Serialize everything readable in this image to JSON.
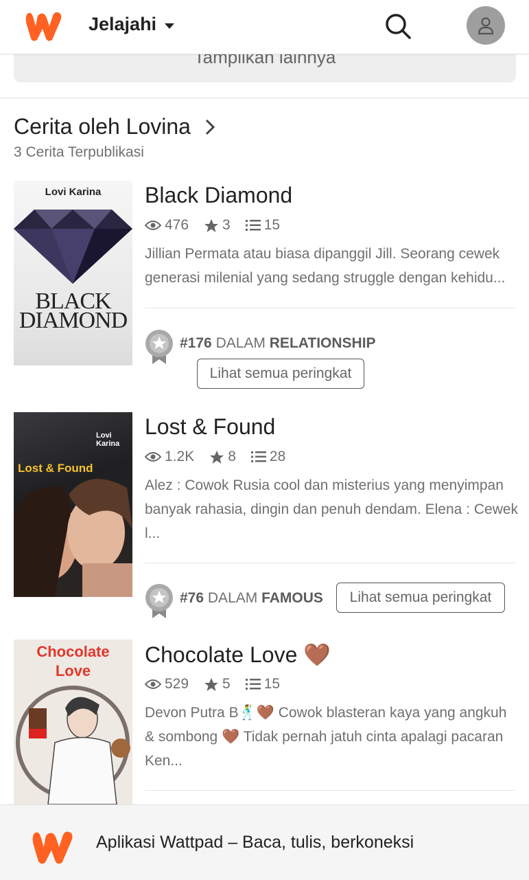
{
  "header": {
    "nav_label": "Jelajahi",
    "logo_icon": "wattpad-logo-icon",
    "search_icon": "search-icon",
    "avatar_icon": "user-icon",
    "brand_color": "#ff6122"
  },
  "show_more": {
    "label": "Tampilkan lainnya"
  },
  "section": {
    "title": "Cerita oleh Lovina",
    "subtitle": "3 Cerita Terpublikasi"
  },
  "stories": [
    {
      "title": "Black Diamond",
      "reads": "476",
      "votes": "3",
      "parts": "15",
      "description": "Jillian Permata atau biasa dipanggil Jill. Seorang cewek generasi milenial yang sedang struggle dengan kehidu...",
      "rank_number": "#176",
      "rank_in": "DALAM",
      "rank_tag": "RELATIONSHIP",
      "rank_button": "Lihat semua peringkat",
      "cover_author": "Lovi Karina",
      "cover_title_line1": "BLACK",
      "cover_title_line2": "DIAMOND"
    },
    {
      "title": "Lost & Found",
      "reads": "1.2K",
      "votes": "8",
      "parts": "28",
      "description": "Alez : Cowok Rusia cool dan misterius yang menyimpan banyak rahasia, dingin dan penuh dendam. Elena : Cewek l...",
      "rank_number": "#76",
      "rank_in": "DALAM",
      "rank_tag": "FAMOUS",
      "rank_button": "Lihat semua peringkat",
      "cover_author": "Lovi Karina",
      "cover_title": "Lost & Found"
    },
    {
      "title": "Chocolate Love 🤎",
      "reads": "529",
      "votes": "5",
      "parts": "15",
      "description": "Devon Putra B🕺🤎 Cowok blasteran kaya yang angkuh & sombong 🤎 Tidak pernah jatuh cinta apalagi pacaran Ken...",
      "cover_title_line1": "Chocolate",
      "cover_title_line2": "Love"
    }
  ],
  "banner": {
    "text": "Aplikasi Wattpad – Baca, tulis, berkoneksi"
  }
}
